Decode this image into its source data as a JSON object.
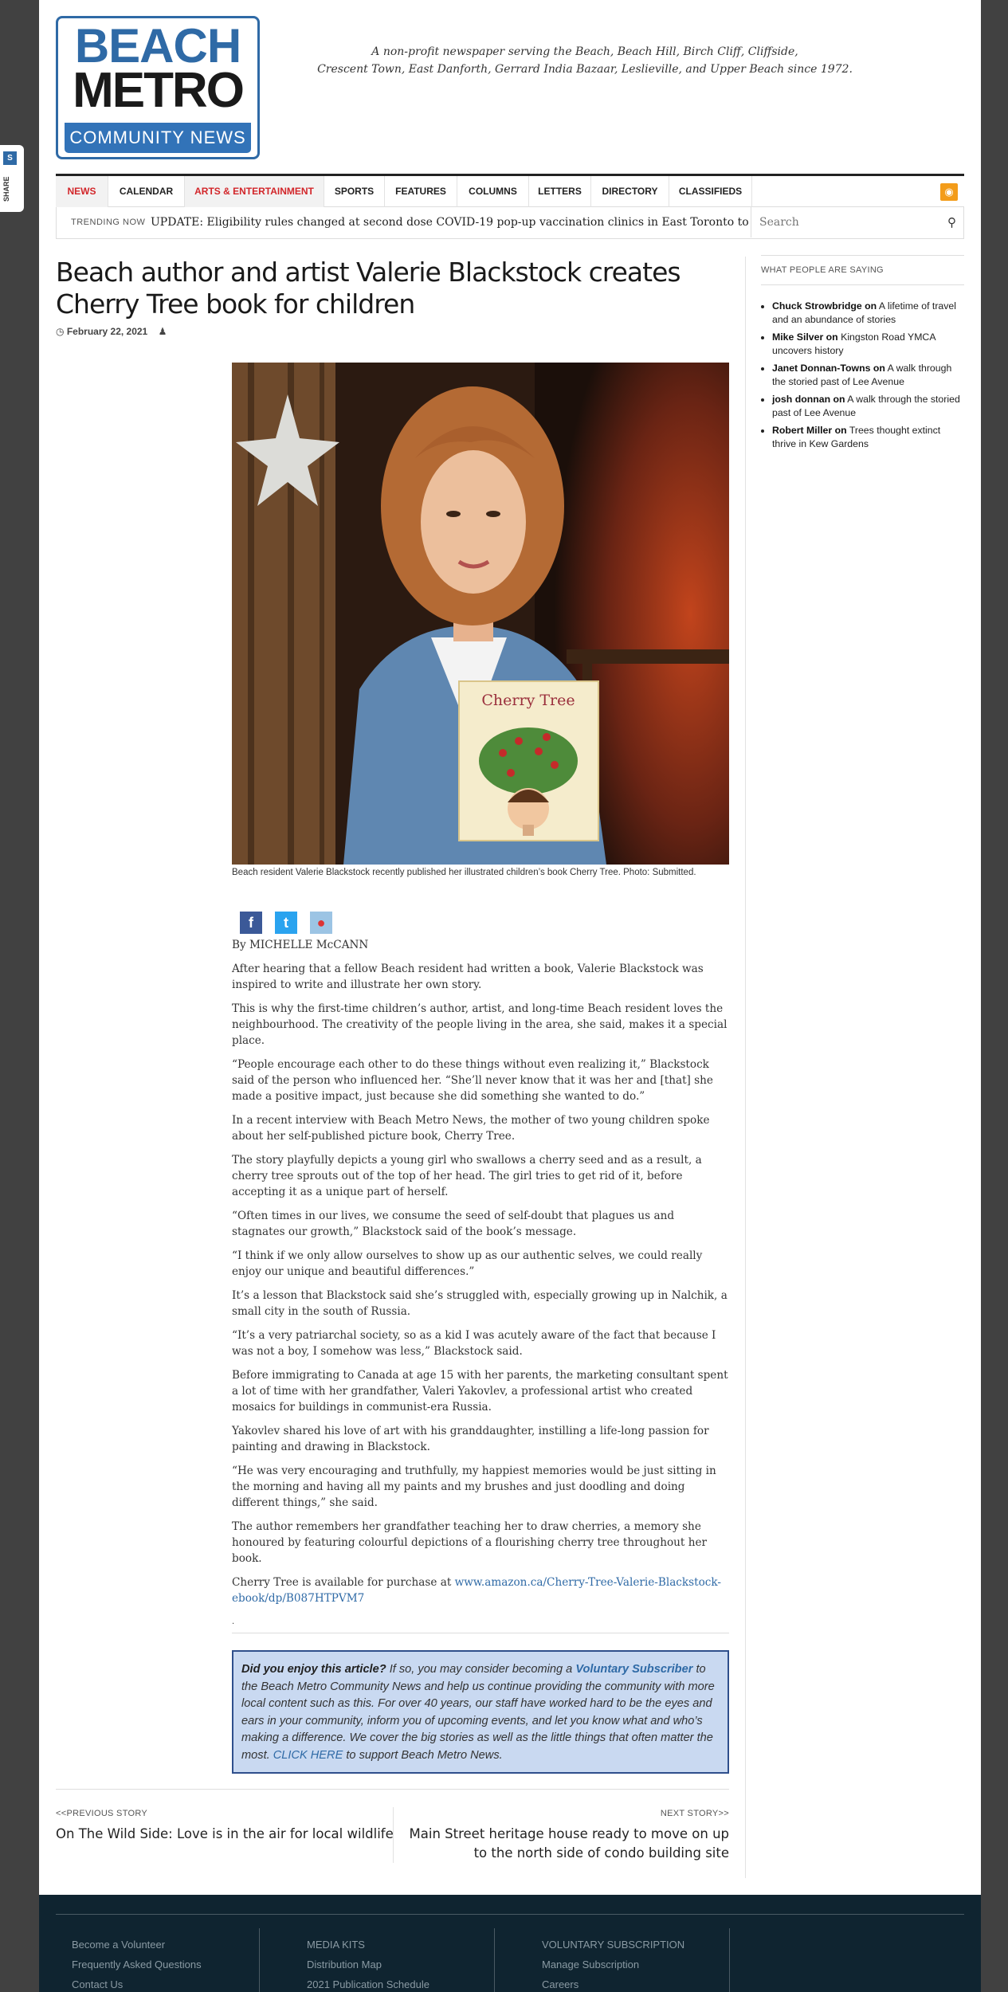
{
  "header": {
    "logo": {
      "line1": "BEACH",
      "line2": "METRO",
      "line3": "COMMUNITY NEWS"
    },
    "tagline_line1": "A non-profit newspaper serving the Beach, Beach Hill, Birch Cliff, Cliffside,",
    "tagline_line2": "Crescent Town, East Danforth, Gerrard India Bazaar, Leslieville, and Upper Beach since 1972."
  },
  "nav": {
    "items": [
      "NEWS",
      "CALENDAR",
      "ARTS & ENTERTAINMENT",
      "SPORTS",
      "FEATURES",
      "COLUMNS",
      "LETTERS",
      "DIRECTORY",
      "CLASSIFIEDS"
    ],
    "accent": "#d2262a"
  },
  "trending": {
    "label": "TRENDING NOW",
    "text": "UPDATE: Eligibility rules changed at second dose COVID-19 pop-up vaccination clinics in East Toronto to",
    "search_placeholder": "Search"
  },
  "share_tab": {
    "label": "SHARE"
  },
  "article": {
    "title": "Beach author and artist Valerie Blackstock creates Cherry Tree book for children",
    "date": "February 22, 2021",
    "book_cover_title": "Cherry Tree",
    "caption": "Beach resident Valerie Blackstock recently published her illustrated children’s book Cherry Tree. Photo: Submitted.",
    "byline": "By MICHELLE McCANN",
    "paragraphs": [
      "After hearing that a fellow Beach resident had written a book, Valerie Blackstock was inspired to write and illustrate her own story.",
      "This is why the first-time children’s author, artist, and long-time Beach resident loves the neighbourhood. The creativity of the people living in the area, she said, makes it a special place.",
      "“People encourage each other to do these things without even realizing it,” Blackstock said of the person who influenced her. “She’ll never know that it was her and [that] she made a positive impact, just because she did something she wanted to do.”",
      "In a recent interview with Beach Metro News, the mother of two young children spoke about her self-published picture book, Cherry Tree.",
      "The story playfully depicts a young girl who swallows a cherry seed and as a result, a cherry tree sprouts out of the top of her head. The girl tries to get rid of it, before accepting it as a unique part of herself.",
      "“Often times in our lives, we consume the seed of self-doubt that plagues us and stagnates our growth,” Blackstock said of the book’s message.",
      "“I think if we only allow ourselves to show up as our authentic selves, we could really enjoy our unique and beautiful differences.”",
      "It’s a lesson that Blackstock said she’s struggled with, especially growing up in Nalchik, a small city in the south of Russia.",
      "“It’s a very patriarchal society, so as a kid I was acutely aware of the fact that because I was not a boy, I somehow was less,” Blackstock said.",
      "Before immigrating to Canada at age 15 with her parents, the marketing consultant spent a lot of time with her grandfather, Valeri Yakovlev, a professional artist who created mosaics for buildings in communist-era Russia.",
      "Yakovlev shared his love of art with his granddaughter, instilling a life-long passion for painting and drawing in Blackstock.",
      "“He was very encouraging and truthfully, my happiest memories would be just sitting in the morning and having all my paints and my brushes and just doodling and doing different things,” she said.",
      "The author remembers her grandfather teaching her to draw cherries, a memory she honoured by featuring colourful depictions of a flourishing cherry tree throughout her book."
    ],
    "purchase_text": "Cherry Tree is available for purchase at ",
    "purchase_link": "www.amazon.ca/Cherry-Tree-Valerie-Blackstock-ebook/dp/B087HTPVM7",
    "dot": "."
  },
  "promo": {
    "lead": "Did you enjoy this article?",
    "t1": " If so, you may consider becoming a ",
    "link1": "Voluntary Subscriber",
    "t2": " to the Beach Metro Community News and help us continue providing the community with more local content such as this. For over 40 years, our staff have worked hard to be the eyes and ears in your community, inform you of upcoming events, and let you know what and who’s making a difference. We cover the big stories as well as the little things that often matter the most. ",
    "link2": "CLICK HERE",
    "t3": " to support Beach Metro News."
  },
  "story_nav": {
    "prev_label": "<<PREVIOUS STORY",
    "prev_title": "On The Wild Side: Love is in the air for local wildlife",
    "next_label": "NEXT STORY>>",
    "next_title": "Main Street heritage house ready to move on up to the north side of condo building site"
  },
  "sidebar": {
    "heading": "WHAT PEOPLE ARE SAYING",
    "comments": [
      {
        "author": "Chuck Strowbridge on",
        "post": "A lifetime of travel and an abundance of stories"
      },
      {
        "author": "Mike Silver on",
        "post": "Kingston Road YMCA uncovers history"
      },
      {
        "author": "Janet Donnan-Towns on",
        "post": "A walk through the storied past of Lee Avenue"
      },
      {
        "author": "josh donnan on",
        "post": "A walk through the storied past of Lee Avenue"
      },
      {
        "author": "Robert Miller on",
        "post": "Trees thought extinct thrive in Kew Gardens"
      }
    ]
  },
  "footer": {
    "col1": [
      "Become a Volunteer",
      "Frequently Asked Questions",
      "Contact Us"
    ],
    "col2": [
      "MEDIA KITS",
      "Distribution Map",
      "2021 Publication Schedule"
    ],
    "col3": [
      "VOLUNTARY SUBSCRIPTION",
      "Manage Subscription",
      "Careers"
    ]
  }
}
